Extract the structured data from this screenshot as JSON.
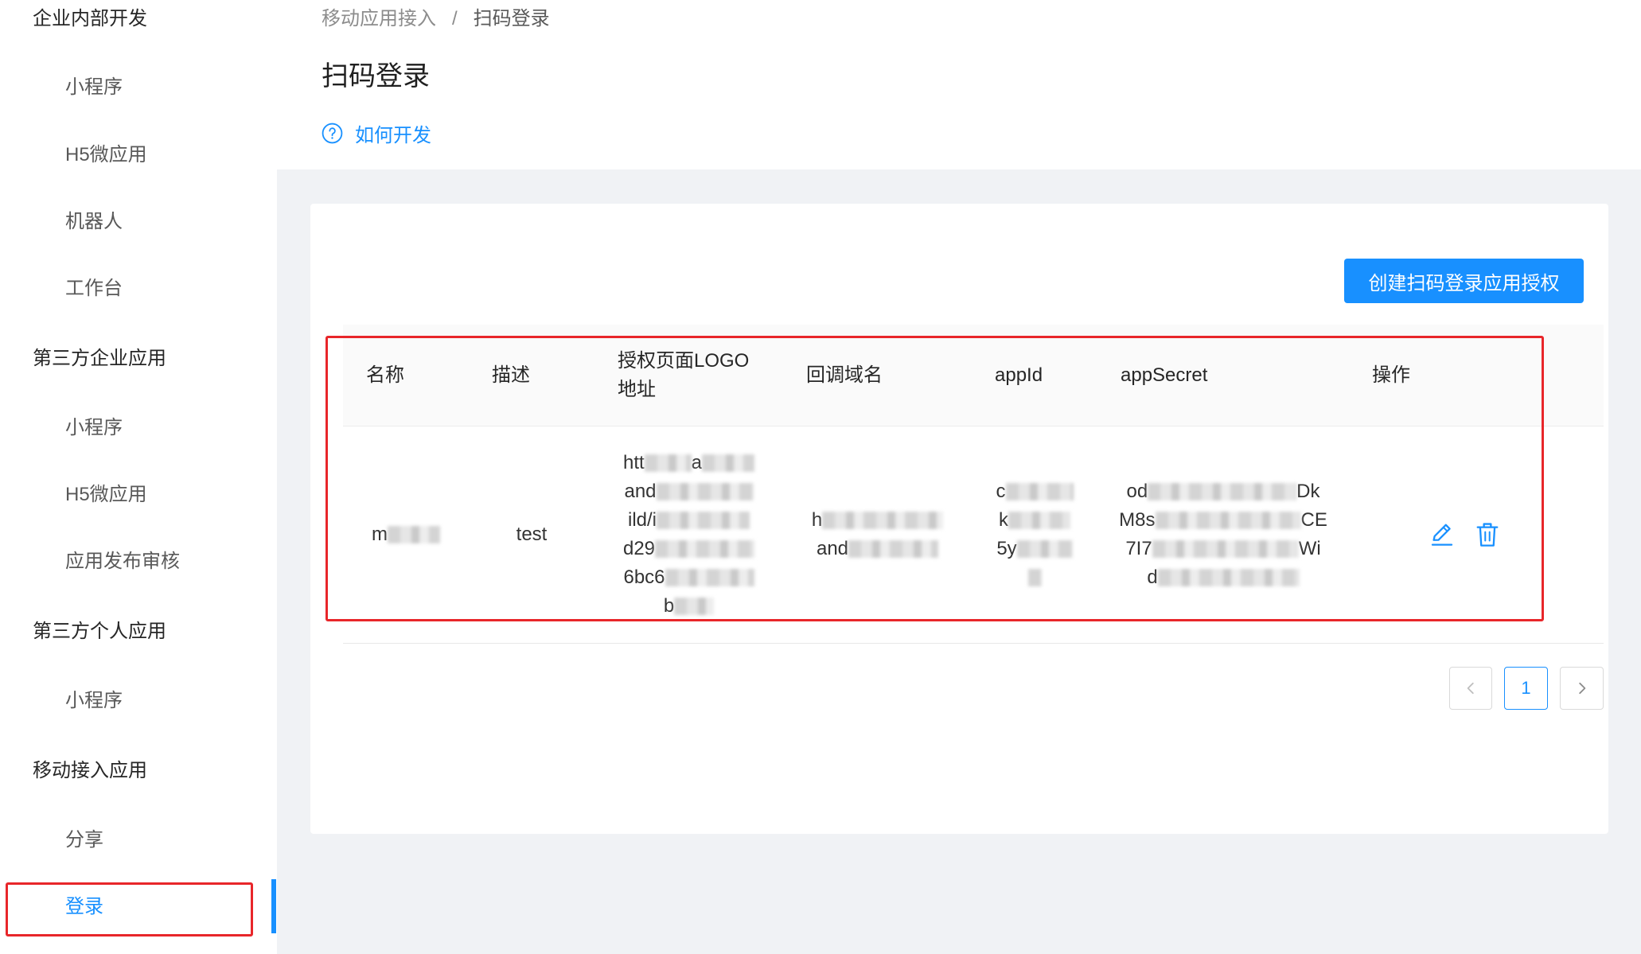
{
  "sidebar": {
    "items": [
      {
        "label": "企业内部开发"
      },
      {
        "label": "小程序"
      },
      {
        "label": "H5微应用"
      },
      {
        "label": "机器人"
      },
      {
        "label": "工作台"
      },
      {
        "label": "第三方企业应用"
      },
      {
        "label": "小程序"
      },
      {
        "label": "H5微应用"
      },
      {
        "label": "应用发布审核"
      },
      {
        "label": "第三方个人应用"
      },
      {
        "label": "小程序"
      },
      {
        "label": "移动接入应用"
      },
      {
        "label": "分享"
      },
      {
        "label": "登录",
        "selected": true
      }
    ]
  },
  "header": {
    "breadcrumb": [
      "移动应用接入",
      "扫码登录"
    ],
    "breadcrumb_separator": "/",
    "title": "扫码登录",
    "help_link": "如何开发"
  },
  "toolbar": {
    "create_button": "创建扫码登录应用授权"
  },
  "table": {
    "headers": [
      {
        "label": "名称"
      },
      {
        "label": "描述"
      },
      {
        "label": "授权页面LOGO",
        "label_line2": "地址"
      },
      {
        "label": "回调域名"
      },
      {
        "label": "appId"
      },
      {
        "label": "appSecret"
      },
      {
        "label": "操作"
      }
    ],
    "rows": [
      {
        "name": [
          "m"
        ],
        "description": "test",
        "logo_url": [
          [
            "htt",
            "a"
          ],
          [
            "and"
          ],
          [
            "ild/i"
          ],
          [
            "d29"
          ],
          [
            "6bc6"
          ],
          [
            "b"
          ]
        ],
        "callback_domain": [
          [
            "h"
          ],
          [
            "and"
          ]
        ],
        "app_id": [
          [
            "c"
          ],
          [
            "k"
          ],
          [
            "5y"
          ]
        ],
        "app_secret": [
          [
            "od",
            "Dk"
          ],
          [
            "M8s",
            "CE"
          ],
          [
            "7I7",
            "Wi"
          ],
          [
            "d"
          ]
        ]
      }
    ]
  },
  "pagination": {
    "current_page": "1"
  },
  "icons": {
    "help": "question-circle-icon",
    "edit": "edit-icon",
    "delete": "delete-icon",
    "prev": "chevron-left-icon",
    "next": "chevron-right-icon"
  },
  "colors": {
    "primary": "#1890ff",
    "highlight_box": "#e8262a",
    "page_background": "#f0f2f5"
  }
}
